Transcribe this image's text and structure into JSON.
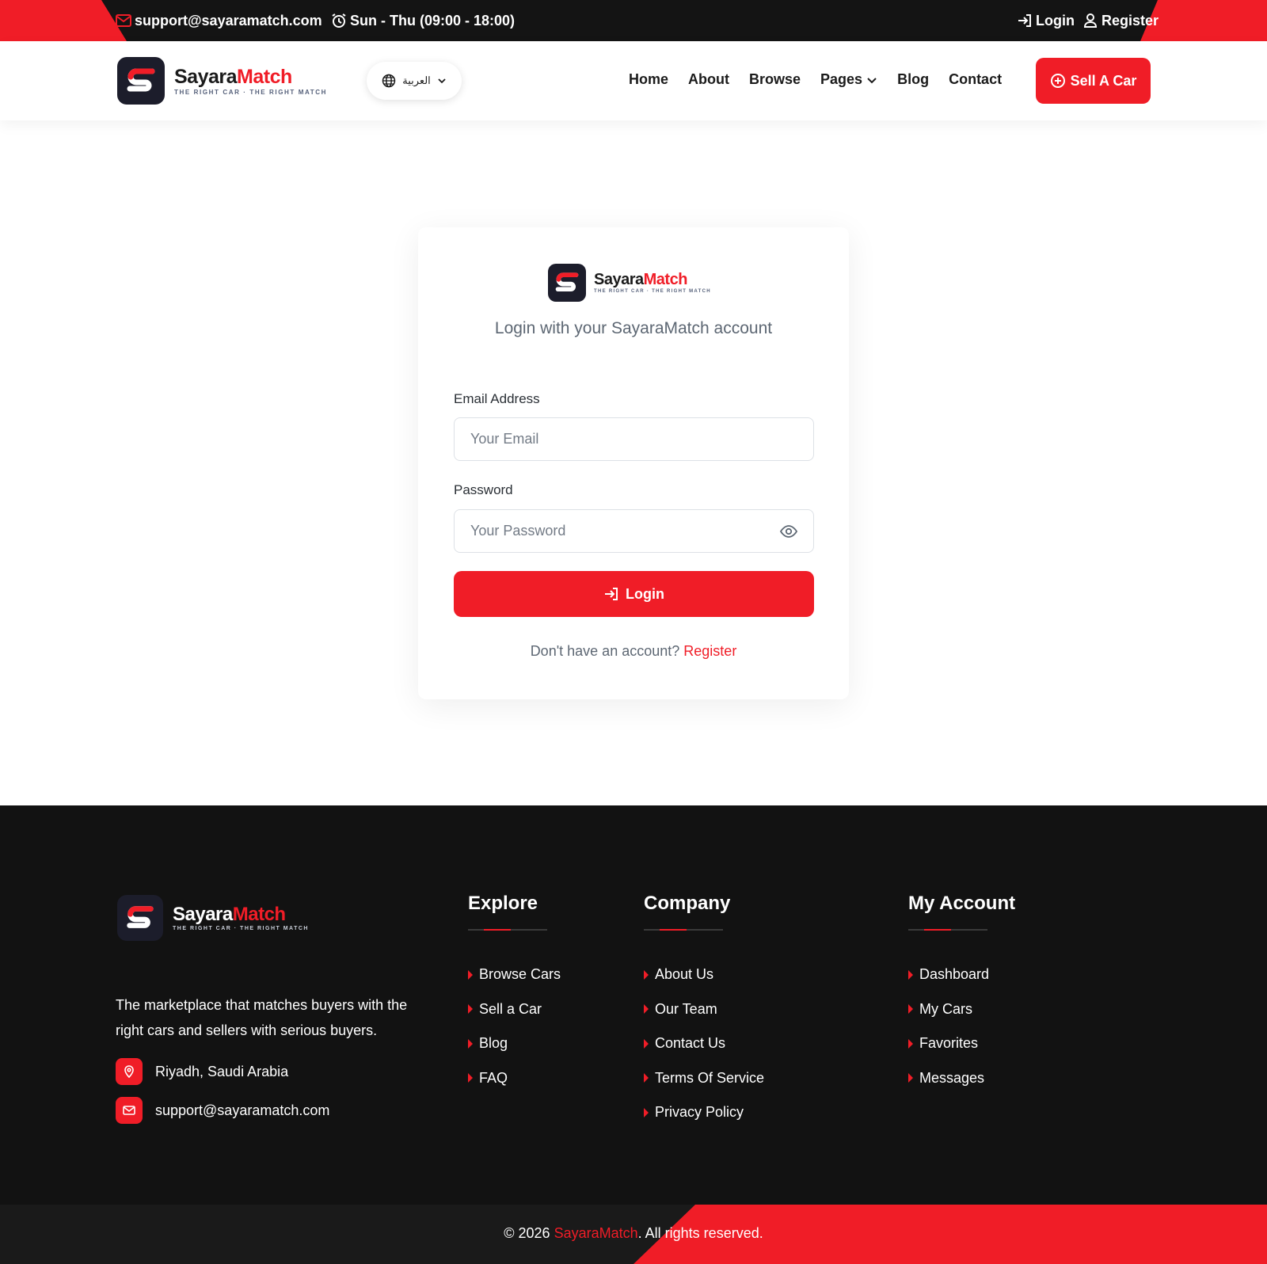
{
  "topbar": {
    "email": "support@sayaramatch.com",
    "hours": "Sun - Thu (09:00 - 18:00)",
    "login": "Login",
    "register": "Register"
  },
  "brand": {
    "name_part1": "Sayara",
    "name_part2": "Match",
    "tagline": "THE RIGHT CAR · THE RIGHT MATCH",
    "primary_color": "#f01d27",
    "dark_color": "#141414"
  },
  "header": {
    "language": "العربية",
    "nav": [
      "Home",
      "About",
      "Browse",
      "Pages",
      "Blog",
      "Contact"
    ],
    "sell_button": "Sell A Car"
  },
  "login_card": {
    "subtitle": "Login with your SayaraMatch account",
    "email_label": "Email Address",
    "email_placeholder": "Your Email",
    "email_value": "",
    "password_label": "Password",
    "password_placeholder": "Your Password",
    "password_value": "",
    "submit": "Login",
    "no_account": "Don't have an account?",
    "register_link": "Register"
  },
  "footer": {
    "description": "The marketplace that matches buyers with the right cars and sellers with serious buyers.",
    "location": "Riyadh, Saudi Arabia",
    "email": "support@sayaramatch.com",
    "columns": [
      {
        "title": "Explore",
        "items": [
          "Browse Cars",
          "Sell a Car",
          "Blog",
          "FAQ"
        ]
      },
      {
        "title": "Company",
        "items": [
          "About Us",
          "Our Team",
          "Contact Us",
          "Terms Of Service",
          "Privacy Policy"
        ]
      },
      {
        "title": "My Account",
        "items": [
          "Dashboard",
          "My Cars",
          "Favorites",
          "Messages"
        ]
      }
    ],
    "copyright_prefix": "© 2026",
    "copyright_brand": "SayaraMatch",
    "copyright_suffix": ". All rights reserved."
  }
}
